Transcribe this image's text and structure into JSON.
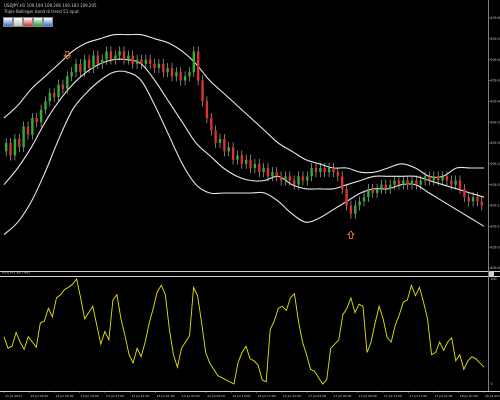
{
  "header": {
    "symbol_line": "USDJPY,H1 109.194 109.206 109.183 109.205",
    "indicator_line": "Triple Bollinger band di trend 51 nput"
  },
  "toolbar": {
    "buttons": [
      "blue",
      "gray",
      "red",
      "green",
      "blue"
    ]
  },
  "colors": {
    "background": "#000000",
    "bull_candle": "#2db32d",
    "bear_candle": "#e03030",
    "band": "#e6e6e6",
    "oscillator": "#e6e600",
    "arrow": "#e07a30"
  },
  "chart_data": [
    {
      "type": "candlestick",
      "title": "USDJPY,H1",
      "indicator": "Bollinger Bands",
      "y_ticks": [
        "109.600",
        "109.550",
        "109.500",
        "109.450",
        "109.400",
        "109.350",
        "109.300",
        "109.250",
        "109.200",
        "109.150",
        "109.100",
        "109.050",
        "109.000"
      ],
      "ylim": [
        109.0,
        109.6
      ],
      "candles": [
        [
          109.28,
          109.3
        ],
        [
          109.3,
          109.27
        ],
        [
          109.27,
          109.31
        ],
        [
          109.31,
          109.29
        ],
        [
          109.29,
          109.34
        ],
        [
          109.34,
          109.32
        ],
        [
          109.32,
          109.36
        ],
        [
          109.36,
          109.35
        ],
        [
          109.35,
          109.38
        ],
        [
          109.38,
          109.4
        ],
        [
          109.4,
          109.42
        ],
        [
          109.42,
          109.41
        ],
        [
          109.41,
          109.44
        ],
        [
          109.44,
          109.43
        ],
        [
          109.43,
          109.46
        ],
        [
          109.46,
          109.47
        ],
        [
          109.47,
          109.49
        ],
        [
          109.49,
          109.47
        ],
        [
          109.47,
          109.5
        ],
        [
          109.5,
          109.48
        ],
        [
          109.48,
          109.51
        ],
        [
          109.51,
          109.49
        ],
        [
          109.49,
          109.5
        ],
        [
          109.5,
          109.52
        ],
        [
          109.52,
          109.5
        ],
        [
          109.5,
          109.51
        ],
        [
          109.51,
          109.52
        ],
        [
          109.52,
          109.5
        ],
        [
          109.5,
          109.51
        ],
        [
          109.51,
          109.49
        ],
        [
          109.49,
          109.5
        ],
        [
          109.5,
          109.49
        ],
        [
          109.49,
          109.5
        ],
        [
          109.5,
          109.49
        ],
        [
          109.49,
          109.48
        ],
        [
          109.48,
          109.49
        ],
        [
          109.49,
          109.47
        ],
        [
          109.47,
          109.48
        ],
        [
          109.48,
          109.46
        ],
        [
          109.46,
          109.47
        ],
        [
          109.47,
          109.45
        ],
        [
          109.45,
          109.46
        ],
        [
          109.46,
          109.47
        ],
        [
          109.47,
          109.52
        ],
        [
          109.52,
          109.45
        ],
        [
          109.45,
          109.4
        ],
        [
          109.4,
          109.36
        ],
        [
          109.36,
          109.33
        ],
        [
          109.33,
          109.3
        ],
        [
          109.3,
          109.31
        ],
        [
          109.31,
          109.28
        ],
        [
          109.28,
          109.29
        ],
        [
          109.29,
          109.26
        ],
        [
          109.26,
          109.27
        ],
        [
          109.27,
          109.25
        ],
        [
          109.25,
          109.26
        ],
        [
          109.26,
          109.24
        ],
        [
          109.24,
          109.25
        ],
        [
          109.25,
          109.23
        ],
        [
          109.23,
          109.24
        ],
        [
          109.24,
          109.22
        ],
        [
          109.22,
          109.23
        ],
        [
          109.23,
          109.22
        ],
        [
          109.22,
          109.21
        ],
        [
          109.21,
          109.22
        ],
        [
          109.22,
          109.21
        ],
        [
          109.21,
          109.2
        ],
        [
          109.2,
          109.22
        ],
        [
          109.22,
          109.21
        ],
        [
          109.21,
          109.22
        ],
        [
          109.22,
          109.24
        ],
        [
          109.24,
          109.23
        ],
        [
          109.23,
          109.24
        ],
        [
          109.24,
          109.23
        ],
        [
          109.23,
          109.24
        ],
        [
          109.24,
          109.23
        ],
        [
          109.23,
          109.22
        ],
        [
          109.22,
          109.19
        ],
        [
          109.19,
          109.15
        ],
        [
          109.15,
          109.13
        ],
        [
          109.13,
          109.15
        ],
        [
          109.15,
          109.16
        ],
        [
          109.16,
          109.17
        ],
        [
          109.17,
          109.19
        ],
        [
          109.19,
          109.18
        ],
        [
          109.18,
          109.19
        ],
        [
          109.19,
          109.2
        ],
        [
          109.2,
          109.19
        ],
        [
          109.19,
          109.2
        ],
        [
          109.2,
          109.21
        ],
        [
          109.21,
          109.2
        ],
        [
          109.2,
          109.21
        ],
        [
          109.21,
          109.2
        ],
        [
          109.2,
          109.21
        ],
        [
          109.21,
          109.2
        ],
        [
          109.2,
          109.21
        ],
        [
          109.21,
          109.22
        ],
        [
          109.22,
          109.21
        ],
        [
          109.21,
          109.22
        ],
        [
          109.22,
          109.21
        ],
        [
          109.21,
          109.22
        ],
        [
          109.22,
          109.21
        ],
        [
          109.21,
          109.2
        ],
        [
          109.2,
          109.21
        ],
        [
          109.21,
          109.19
        ],
        [
          109.19,
          109.17
        ],
        [
          109.17,
          109.16
        ],
        [
          109.16,
          109.17
        ],
        [
          109.17,
          109.16
        ],
        [
          109.16,
          109.15
        ]
      ],
      "upper_band": [
        109.36,
        109.39,
        109.43,
        109.46,
        109.49,
        109.52,
        109.54,
        109.55,
        109.56,
        109.56,
        109.56,
        109.55,
        109.54,
        109.52,
        109.49,
        109.45,
        109.42,
        109.39,
        109.36,
        109.33,
        109.3,
        109.28,
        109.26,
        109.25,
        109.24,
        109.24,
        109.23,
        109.23,
        109.24,
        109.25,
        109.24,
        109.22,
        109.22,
        109.24,
        109.24,
        109.24
      ],
      "middle_band": [
        109.2,
        109.24,
        109.29,
        109.35,
        109.4,
        109.44,
        109.47,
        109.49,
        109.5,
        109.5,
        109.49,
        109.45,
        109.4,
        109.35,
        109.3,
        109.27,
        109.24,
        109.22,
        109.21,
        109.21,
        109.22,
        109.2,
        109.19,
        109.19,
        109.19,
        109.2,
        109.21,
        109.22,
        109.22,
        109.22,
        109.22,
        109.21,
        109.2,
        109.19,
        109.18,
        109.17
      ],
      "lower_band": [
        109.08,
        109.11,
        109.16,
        109.23,
        109.31,
        109.38,
        109.42,
        109.45,
        109.47,
        109.47,
        109.45,
        109.39,
        109.32,
        109.25,
        109.2,
        109.18,
        109.18,
        109.18,
        109.18,
        109.18,
        109.16,
        109.13,
        109.11,
        109.12,
        109.14,
        109.16,
        109.18,
        109.19,
        109.19,
        109.2,
        109.2,
        109.18,
        109.16,
        109.14,
        109.12,
        109.1
      ],
      "arrows": [
        {
          "candle": 14,
          "direction": "down"
        },
        {
          "candle": 79,
          "direction": "up"
        }
      ]
    },
    {
      "type": "line",
      "title": "RSI(14) 38.7962",
      "y_ticks": [
        "100",
        "0"
      ],
      "ylim": [
        0,
        100
      ],
      "values": [
        45,
        34,
        36,
        49,
        40,
        33,
        45,
        40,
        35,
        58,
        60,
        72,
        64,
        82,
        85,
        90,
        92,
        95,
        100,
        82,
        62,
        68,
        74,
        56,
        38,
        50,
        42,
        80,
        85,
        62,
        46,
        28,
        20,
        34,
        26,
        40,
        58,
        72,
        88,
        94,
        85,
        52,
        28,
        16,
        34,
        40,
        46,
        92,
        84,
        58,
        30,
        20,
        14,
        8,
        6,
        4,
        2,
        0,
        20,
        30,
        36,
        24,
        22,
        18,
        4,
        2,
        52,
        60,
        72,
        74,
        70,
        82,
        86,
        60,
        40,
        28,
        14,
        12,
        6,
        0,
        4,
        34,
        38,
        42,
        66,
        72,
        82,
        68,
        76,
        74,
        30,
        40,
        58,
        74,
        62,
        44,
        40,
        56,
        66,
        78,
        80,
        94,
        84,
        92,
        78,
        62,
        28,
        30,
        40,
        32,
        40,
        44,
        22,
        28,
        14,
        22,
        26,
        24,
        20,
        16
      ]
    }
  ],
  "x_labels": [
    "13 Jul 2017",
    "13 Jul 05:00",
    "13 Jul 09:00",
    "13 Jul 13:00",
    "13 Jul 17:00",
    "13 Jul 21:00",
    "14 Jul 01:00",
    "14 Jul 05:00",
    "14 Jul 09:00",
    "14 Jul 13:00",
    "14 Jul 17:00",
    "14 Jul 21:00",
    "17 Jul 01:00",
    "17 Jul 05:00",
    "17 Jul 09:00",
    "17 Jul 13:00",
    "17 Jul 17:00",
    "17 Jul 21:00",
    "18 Jul 01:00",
    "18 Jul 05:00"
  ]
}
